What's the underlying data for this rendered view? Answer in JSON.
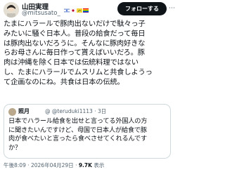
{
  "author": {
    "name": "山田実理",
    "handle": "@mitsusato_",
    "flag_colors": [
      "#ffffff",
      "#0038b8",
      "#000000",
      "#e40303",
      "#ff8c00",
      "#008026",
      "#732982"
    ]
  },
  "follow_label": "フォローする",
  "more_glyph": "⋯",
  "tweet_text": "たまにハラールで豚肉出ないだけで駄々っ子\nみたいに騒ぐ日本人。普段の給食だって毎日\nは豚肉出ないだろうに。そんなに豚肉好きな\nらお母さんに毎日作って貰えばいいだろ。豚\n肉は沖縄を除く日本では伝統料理ではない\nし、たまにハラールでムスリムと共食しようっ\nて企画なのにね。共食は日本の伝統。",
  "quote": {
    "name": "照月",
    "handle": "@ @teruduki1113 · 3日",
    "text": "日本でハラール給食を出せと言ってる外国人の方\nに聞きたいんですけど、母国で日本人が給食で豚\n肉が食べたいと言ったら食べさせてくれるんです\nか？"
  },
  "meta": {
    "time": "午後8:09 · 2026年04月29日",
    "views": "9.7K",
    "views_label": "表示"
  }
}
